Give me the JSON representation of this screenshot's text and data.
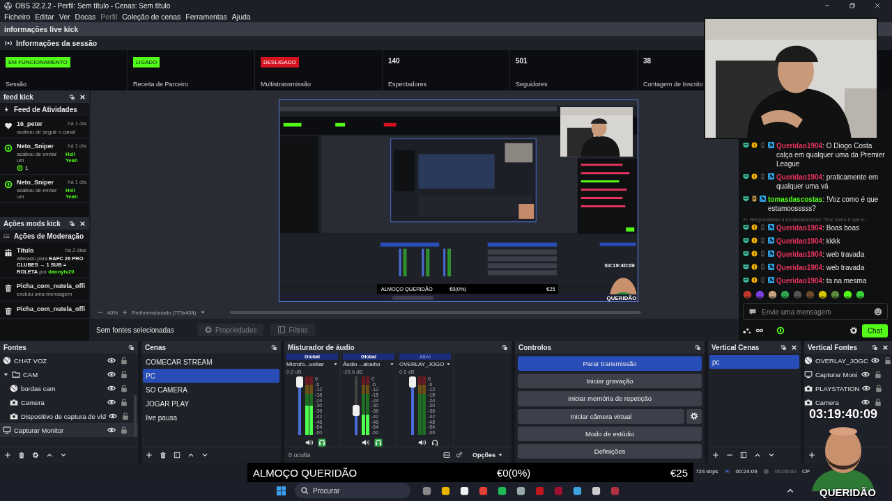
{
  "window": {
    "title": "OBS 32.2.2 - Perfil: Sem título - Cenas: Sem título"
  },
  "menu": [
    {
      "label": "Ficheiro",
      "disabled": false
    },
    {
      "label": "Editar",
      "disabled": false
    },
    {
      "label": "Ver",
      "disabled": false
    },
    {
      "label": "Docas",
      "disabled": false
    },
    {
      "label": "Perfil",
      "disabled": true
    },
    {
      "label": "Coleção de cenas",
      "disabled": false
    },
    {
      "label": "Ferramentas",
      "disabled": false
    },
    {
      "label": "Ajuda",
      "disabled": false
    }
  ],
  "info_dock": {
    "title": "informações live kick",
    "section": "Informações da sessão",
    "stats": [
      {
        "kind": "badge",
        "value": "EM FUNCIONAMENTO",
        "color": "#53fc18",
        "label": "Sessão"
      },
      {
        "kind": "badge",
        "value": "LIGADO",
        "color": "#53fc18",
        "label": "Receita de Parceiro"
      },
      {
        "kind": "badge",
        "value": "DESLIGADO",
        "color": "#d3131f",
        "label": "Multistransmissão"
      },
      {
        "kind": "number",
        "value": "140",
        "label": "Espectadores"
      },
      {
        "kind": "number",
        "value": "501",
        "label": "Seguidores"
      },
      {
        "kind": "number",
        "value": "38",
        "label": "Contagem de Inscrito"
      }
    ]
  },
  "feed_dock": {
    "title": "feed kick",
    "heading": "Feed de Atividades",
    "events": [
      {
        "kind": "follow",
        "user": "16_peter",
        "time": "há 1 dia",
        "text": "acabou de seguir o canal"
      },
      {
        "kind": "gift",
        "user": "Neto_Sniper",
        "time": "há 1 dia",
        "text": "acabou de enviar um",
        "item": "Hell Yeah",
        "count": "1"
      },
      {
        "kind": "gift",
        "user": "Neto_Sniper",
        "time": "há 1 dia",
        "text": "acabou de enviar um",
        "item": "Hell Yeah"
      }
    ]
  },
  "mods_dock": {
    "title": "Ações mods kick",
    "heading": "Ações de Moderação",
    "actions": [
      {
        "kind": "title",
        "user": "Título",
        "time": "há 2 dias",
        "text": "alterado para **EAFC 26 PRO CLUBES → 1 SUB = ROLETA** por",
        "by": "dannytv20"
      },
      {
        "kind": "delete",
        "user": "Picha_com_nutela_offi",
        "text": "excluiu uma mensagem"
      },
      {
        "kind": "delete",
        "user": "Picha_com_nutela_offi"
      }
    ]
  },
  "preview": {
    "overlay": {
      "title": "ALMOÇO QUERIDÃO",
      "progress": "€0(0%)",
      "goal": "€25"
    },
    "timer": "03:19:40:09",
    "logo": "QUERIDÃO",
    "zoom": "40%",
    "size": "Redimensionado (773x434)"
  },
  "source_bar": {
    "status": "Sem fontes selecionadas",
    "buttons": [
      {
        "label": "Propriedades",
        "kind": "gear",
        "disabled": true
      },
      {
        "label": "Filtros",
        "kind": "filter",
        "disabled": true
      }
    ]
  },
  "chat": {
    "messages": [
      {
        "kind": "full",
        "user": "Queridao1904",
        "color": "#e8345e",
        "text": ": O Diogo Costa calça em qualquer uma da Premier League"
      },
      {
        "kind": "full",
        "user": "Queridao1904",
        "color": "#e8345e",
        "text": ": praticamente em qualquer uma vá"
      },
      {
        "kind": "short",
        "user": "tomasdascostas",
        "color": "#53fc18",
        "text": ": !Voz como é que estamoosssss?"
      },
      {
        "kind": "full",
        "user": "Queridao1904",
        "color": "#e8345e",
        "text": ": Boas boas",
        "reply": "Respondendo a tomasdascostas: !Voz como é que e..."
      },
      {
        "kind": "full",
        "user": "Queridao1904",
        "color": "#e8345e",
        "text": ": kkkk"
      },
      {
        "kind": "full",
        "user": "Queridao1904",
        "color": "#e8345e",
        "text": ": web travada"
      },
      {
        "kind": "full",
        "user": "Queridao1904",
        "color": "#e8345e",
        "text": ": web travada"
      },
      {
        "kind": "full",
        "user": "Queridao1904",
        "color": "#e8345e",
        "text": ": ta na mesma"
      }
    ],
    "placeholder": "Envie uma mensagem",
    "send": "Chat"
  },
  "sources": {
    "title": "Fontes",
    "items": [
      {
        "name": "CHAT VOZ",
        "kind": "browser",
        "visible": true,
        "locked": false,
        "hovered": false
      },
      {
        "name": "CAM",
        "kind": "group",
        "expanded": true,
        "visible": true,
        "locked": false,
        "hovered": false,
        "children": [
          {
            "name": "bordas cam",
            "kind": "browser",
            "visible": true,
            "locked": false,
            "hovered": false
          },
          {
            "name": "Camera",
            "kind": "camera",
            "visible": true,
            "locked": false,
            "hovered": false
          },
          {
            "name": "Dispositivo de captura de víd",
            "kind": "camera",
            "visible": true,
            "locked": false,
            "hovered": false
          }
        ]
      },
      {
        "name": "Capturar Monitor",
        "kind": "monitor",
        "visible": true,
        "locked": false,
        "hovered": true
      }
    ]
  },
  "scenes": {
    "title": "Cenas",
    "items": [
      {
        "name": "COMECAR STREAM",
        "selected": false
      },
      {
        "name": "PC",
        "selected": true
      },
      {
        "name": "SO CAMERA",
        "selected": false
      },
      {
        "name": "JOGAR PLAY",
        "selected": false
      },
      {
        "name": "live pausa",
        "selected": false
      }
    ]
  },
  "mixer": {
    "title": "Misturador de áudio",
    "channels": [
      {
        "header": "Global",
        "active": false,
        "name": "Microfo...uxiliar",
        "reading": "0.0 dB",
        "level": 1.0,
        "meter": {
          "level": 0.5
        },
        "monitoring": true,
        "scale": [
          "0",
          "-6",
          "-12",
          "-18",
          "-24",
          "-30",
          "-36",
          "-42",
          "-48",
          "-54",
          "-60"
        ]
      },
      {
        "header": "Global",
        "active": false,
        "name": "Áudio ...abalho",
        "reading": "-26.6 dB",
        "level": 0.4,
        "meter": {
          "level": 0.35
        },
        "monitoring": true,
        "scale": [
          "0",
          "-6",
          "-12",
          "-18",
          "-24",
          "-30",
          "-36",
          "-42",
          "-48",
          "-54",
          "-60"
        ]
      },
      {
        "header": "Ativo",
        "active": true,
        "name": "OVERLAY_JOGO",
        "reading": "0.0 dB",
        "level": 1.0,
        "meter": {
          "level": 0
        },
        "monitoring": false,
        "scale": [
          "0",
          "-6",
          "-12",
          "-18",
          "-24",
          "-30",
          "-36",
          "-42",
          "-48",
          "-54",
          "-60"
        ]
      }
    ],
    "hidden": "0 oculta",
    "options": "Opções"
  },
  "controls": {
    "title": "Controlos",
    "buttons": [
      {
        "label": "Parar transmissão",
        "kind": "plain",
        "active": true
      },
      {
        "label": "Iniciar gravação",
        "kind": "plain",
        "active": false
      },
      {
        "label": "Iniciar memória de repetição",
        "kind": "plain",
        "active": false
      },
      {
        "label": "Iniciar câmera virtual",
        "kind": "split",
        "active": false
      },
      {
        "label": "Modo de estúdio",
        "kind": "plain",
        "active": false
      },
      {
        "label": "Definições",
        "kind": "plain",
        "active": false
      }
    ]
  },
  "vertical_scenes": {
    "title": "Vertical Cenas",
    "items": [
      {
        "name": "pc",
        "selected": true
      }
    ]
  },
  "vertical_sources": {
    "title": "Vertical Fontes",
    "items": [
      {
        "name": "OVERLAY_JOGC",
        "kind": "browser"
      },
      {
        "name": "Capturar Moni",
        "kind": "monitor"
      },
      {
        "name": "PLAYSTATION",
        "kind": "camera"
      },
      {
        "name": "Camera",
        "kind": "camera"
      }
    ]
  },
  "overlay_bar": {
    "title": "ALMOÇO QUERIDÃO",
    "progress": "€0(0%)",
    "goal": "€25"
  },
  "status_bar": {
    "bitrate": "724 kbps",
    "stream_time": "00:24:09",
    "rec_time": "00:00:00",
    "cpu": "CP"
  },
  "cam_overlay": {
    "timer": "03:19:40:09",
    "logo": "QUERIDÃO"
  },
  "taskbar": {
    "search": "Procurar"
  }
}
